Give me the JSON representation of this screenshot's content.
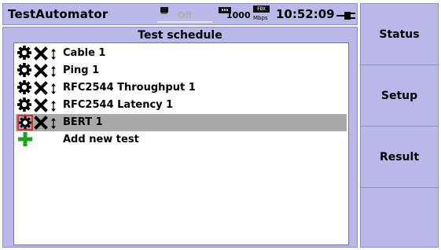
{
  "title_bar": {
    "app_name": "TestAutomator",
    "off_label": "Off",
    "speed_value": "1000",
    "duplex_badge": "FDX",
    "speed_unit": "Mbps",
    "time": "10:52:09",
    "icons": [
      "monitor-icon",
      "ethernet-port-icon",
      "power-plug-icon"
    ]
  },
  "panel": {
    "title": "Test schedule",
    "tests": [
      {
        "label": "Cable 1",
        "selected": false
      },
      {
        "label": "Ping 1",
        "selected": false
      },
      {
        "label": "RFC2544 Throughput 1",
        "selected": false
      },
      {
        "label": "RFC2544 Latency 1",
        "selected": false
      },
      {
        "label": "BERT 1",
        "selected": true
      }
    ],
    "add_label": "Add new test",
    "row_icons": [
      "gear-icon",
      "close-icon",
      "reorder-icon"
    ],
    "add_icon": "plus-icon"
  },
  "side_buttons": {
    "status": "Status",
    "setup": "Setup",
    "result": "Result",
    "empty": ""
  },
  "colors": {
    "panel_bg": "#b8b9e8",
    "selection": "#a8a8a8",
    "highlight_border": "#d93030",
    "add_icon": "#1fa01f"
  }
}
